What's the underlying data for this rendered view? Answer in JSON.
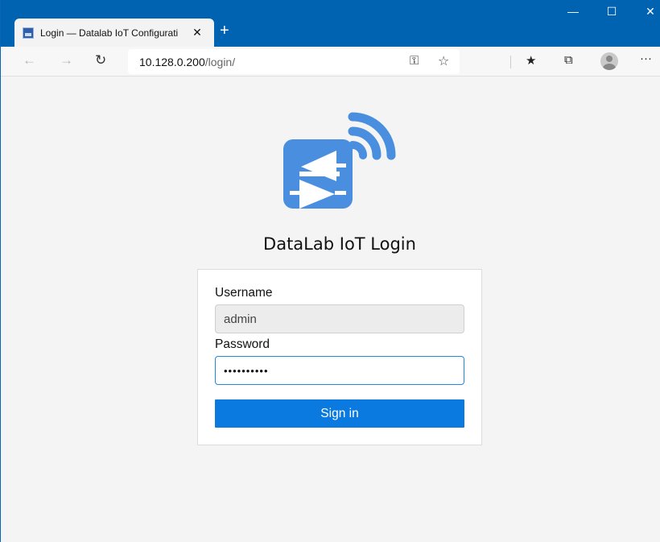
{
  "browser": {
    "tab_title": "Login — Datalab IoT Configurati",
    "tab_close": "✕",
    "new_tab": "+",
    "window_controls": {
      "minimize": "—",
      "maximize": "☐",
      "close": "✕"
    },
    "nav": {
      "back": "←",
      "forward": "→",
      "refresh": "↻"
    },
    "address": {
      "host": "10.128.0.200",
      "path": "/login/"
    },
    "toolbar": {
      "key": "⚿",
      "favorite": "☆",
      "favorites_list": "★",
      "collections": "⧉",
      "more": "···"
    }
  },
  "page": {
    "title": "DataLab IoT Login",
    "username_label": "Username",
    "username_value": "admin",
    "password_label": "Password",
    "password_value": "••••••••••",
    "signin_label": "Sign in"
  },
  "colors": {
    "titlebar": "#0063b1",
    "logo_blue": "#4a8fdf",
    "button": "#0a7ae0"
  },
  "icons": [
    "favicon-icon",
    "close-icon",
    "plus-icon",
    "minimize-icon",
    "maximize-icon",
    "back-icon",
    "forward-icon",
    "refresh-icon",
    "key-icon",
    "star-icon",
    "favorites-icon",
    "collections-icon",
    "profile-avatar-icon",
    "more-icon",
    "datalab-logo-icon"
  ]
}
